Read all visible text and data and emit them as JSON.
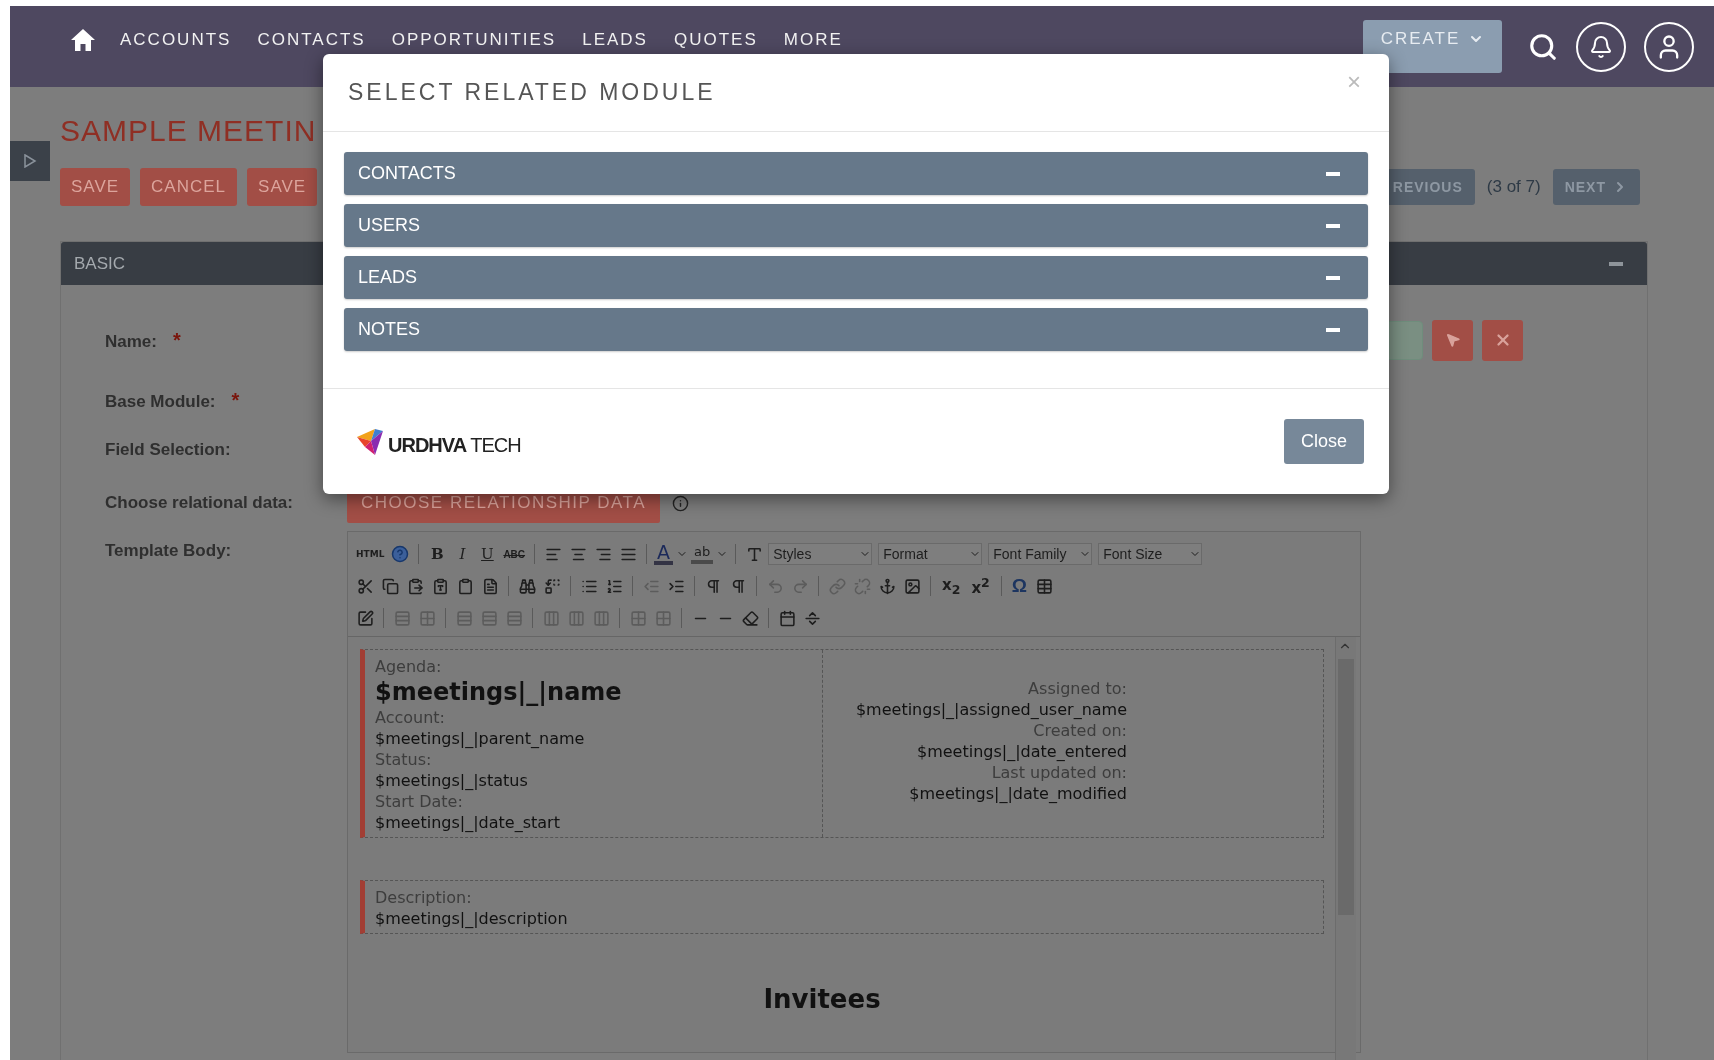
{
  "nav": {
    "items": [
      {
        "label": "ACCOUNTS"
      },
      {
        "label": "CONTACTS"
      },
      {
        "label": "OPPORTUNITIES"
      },
      {
        "label": "LEADS"
      },
      {
        "label": "QUOTES"
      },
      {
        "label": "MORE"
      }
    ],
    "create": "CREATE"
  },
  "page": {
    "title": "SAMPLE MEETIN",
    "buttons": [
      "SAVE",
      "CANCEL",
      "SAVE"
    ],
    "pager": {
      "previous": "REVIOUS",
      "count": "(3 of 7)",
      "next": "NEXT"
    }
  },
  "panel": {
    "title": "BASIC",
    "expanded": true,
    "required_mark": "*",
    "fields": [
      {
        "label": "Name:",
        "required": true,
        "kind": "name"
      },
      {
        "label": "Base Module:",
        "required": true,
        "kind": "plain"
      },
      {
        "label": "Field Selection:",
        "required": false,
        "kind": "plain"
      },
      {
        "label": "Choose relational data:",
        "required": false,
        "kind": "relationship",
        "button": "CHOOSE RELATIONSHIP DATA"
      },
      {
        "label": "Template Body:",
        "required": false,
        "kind": "editor"
      }
    ]
  },
  "editor": {
    "toolbar": {
      "html": "HTML",
      "format_buttons": [
        "B",
        "I",
        "U",
        "ABC"
      ],
      "text_color": "A",
      "highlight": "ab",
      "selects": [
        "Styles",
        "Format",
        "Font Family",
        "Font Size"
      ],
      "scripts": [
        "x$_{2}$",
        "x$^{2}$"
      ],
      "special_char": "Ω"
    },
    "content": {
      "left": [
        {
          "label": "Agenda:",
          "value": "$meetings|_|name",
          "kind": "heading"
        },
        {
          "label": "Account:",
          "value": "$meetings|_|parent_name",
          "kind": "plain"
        },
        {
          "label": "Status:",
          "value": "$meetings|_|status",
          "kind": "plain"
        },
        {
          "label": "Start Date:",
          "value": "$meetings|_|date_start",
          "kind": "plain"
        }
      ],
      "right": [
        {
          "label": "Assigned to:",
          "value": "$meetings|_|assigned_user_name"
        },
        {
          "label": "Created on:",
          "value": "$meetings|_|date_entered"
        },
        {
          "label": "Last updated on:",
          "value": "$meetings|_|date_modified"
        }
      ],
      "description": {
        "label": "Description:",
        "value": "$meetings|_|description"
      },
      "heading": "Invitees"
    }
  },
  "modal": {
    "title": "SELECT RELATED MODULE",
    "close_glyph": "×",
    "sections": [
      {
        "label": "CONTACTS",
        "expanded": true
      },
      {
        "label": "USERS",
        "expanded": true
      },
      {
        "label": "LEADS",
        "expanded": true
      },
      {
        "label": "NOTES",
        "expanded": true
      }
    ],
    "logo": "**URDHVA** TECH",
    "close_button": "Close"
  }
}
